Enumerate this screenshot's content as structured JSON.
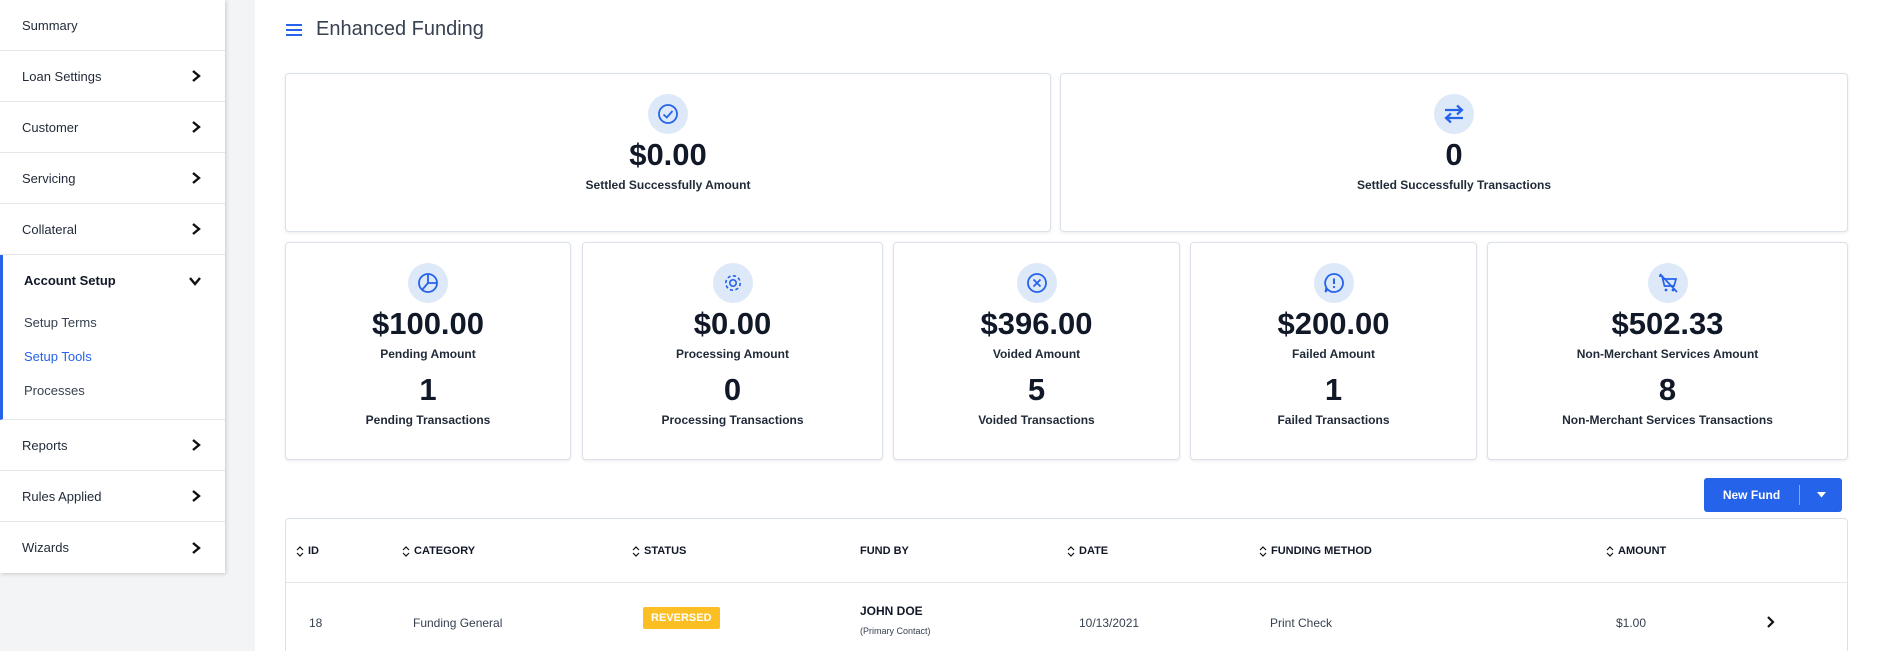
{
  "sidebar": {
    "items_top": [
      {
        "label": "Summary"
      },
      {
        "label": "Loan Settings"
      },
      {
        "label": "Customer"
      },
      {
        "label": "Servicing"
      },
      {
        "label": "Collateral"
      }
    ],
    "group": {
      "label": "Account Setup",
      "sub": [
        {
          "label": "Setup Terms"
        },
        {
          "label": "Setup Tools"
        },
        {
          "label": "Processes"
        }
      ]
    },
    "items_bottom": [
      {
        "label": "Reports"
      },
      {
        "label": "Rules Applied"
      },
      {
        "label": "Wizards"
      }
    ]
  },
  "page": {
    "title": "Enhanced Funding"
  },
  "summary": {
    "settled_amount": {
      "value": "$0.00",
      "label": "Settled Successfully Amount",
      "icon": "check-circle-icon"
    },
    "settled_tx": {
      "value": "0",
      "label": "Settled Successfully Transactions",
      "icon": "transfer-arrows-icon"
    }
  },
  "stats": [
    {
      "amount": "$100.00",
      "amount_label": "Pending Amount",
      "count": "1",
      "count_label": "Pending Transactions",
      "icon": "pie-chart-icon"
    },
    {
      "amount": "$0.00",
      "amount_label": "Processing Amount",
      "count": "0",
      "count_label": "Processing Transactions",
      "icon": "gear-icon"
    },
    {
      "amount": "$396.00",
      "amount_label": "Voided Amount",
      "count": "5",
      "count_label": "Voided Transactions",
      "icon": "x-circle-icon"
    },
    {
      "amount": "$200.00",
      "amount_label": "Failed Amount",
      "count": "1",
      "count_label": "Failed Transactions",
      "icon": "alert-bubble-icon"
    },
    {
      "amount": "$502.33",
      "amount_label": "Non-Merchant Services Amount",
      "count": "8",
      "count_label": "Non-Merchant Services Transactions",
      "icon": "cart-off-icon"
    }
  ],
  "actions": {
    "new_fund": "New Fund"
  },
  "table": {
    "columns": [
      "ID",
      "CATEGORY",
      "STATUS",
      "FUND BY",
      "DATE",
      "FUNDING METHOD",
      "AMOUNT"
    ],
    "rows": [
      {
        "id": "18",
        "category": "Funding General",
        "status": "REVERSED",
        "fund_by": "JOHN DOE",
        "fund_by_sub": "(Primary Contact)",
        "date": "10/13/2021",
        "method": "Print Check",
        "amount": "$1.00"
      }
    ]
  },
  "colors": {
    "accent": "#2563eb",
    "badge_reversed": "#fbbf24",
    "icon_bg": "#dde8f8"
  }
}
